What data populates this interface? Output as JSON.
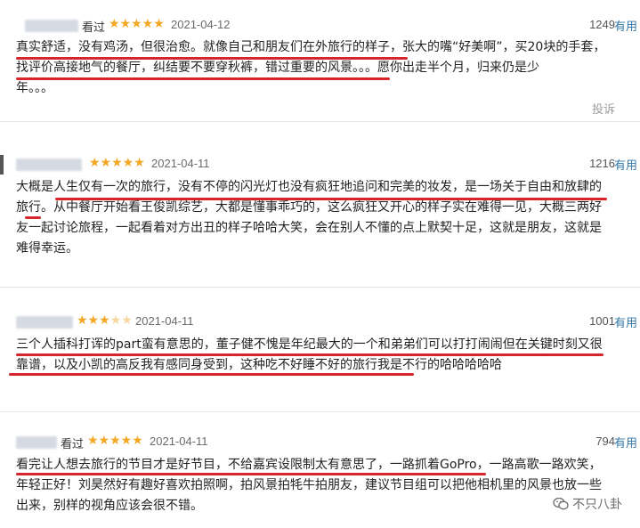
{
  "reviews": [
    {
      "seen_label": "看过",
      "stars": 5,
      "date": "2021-04-12",
      "votes": "1249",
      "useful_label": "有用",
      "lines": [
        "真实舒适，没有鸡汤，但很治愈。就像自己和朋友们在外旅行的样子，张大的嘴“好美啊”，买20块的手套，",
        "找评价高接地气的餐厅，纠结要不要穿秋裤，错过重要的风景。。。愿你出走半个月，归来仍是少",
        "年。。。"
      ],
      "report_label": "投诉"
    },
    {
      "seen_label": "看过",
      "stars": 5,
      "date": "2021-04-11",
      "votes": "1216",
      "useful_label": "有用",
      "lines": [
        "大概是人生仅有一次的旅行，没有不停的闪光灯也没有疯狂地追问和完美的妆发，是一场关于自由和放肆的",
        "旅行。从中餐厅开始看王俊凯综艺，大都是懂事乖巧的，这么疯狂又开心的样子实在难得一见，大概三两好",
        "友一起讨论旅程，一起看着对方出丑的样子哈哈大笑，会在别人不懂的点上默契十足，这就是朋友，这就是",
        "难得幸运。"
      ]
    },
    {
      "seen_label": "",
      "stars": 3,
      "date": "2021-04-11",
      "votes": "1001",
      "useful_label": "有用",
      "lines": [
        "三个人插科打诨的part蛮有意思的，董子健不愧是年纪最大的一个和弟弟们可以打打闹闹但在关键时刻又很",
        "靠谱，以及小凯的高反我有感同身受到，这种吃不好睡不好的旅行我是不行的哈哈哈哈哈"
      ]
    },
    {
      "seen_label": "看过",
      "stars": 5,
      "date": "2021-04-11",
      "votes": "794",
      "useful_label": "有用",
      "lines": [
        "看完让人想去旅行的节目才是好节目，不给嘉宾设限制太有意思了，一路抓着GoPro，一路高歌一路欢笑，",
        "年轻正好！刘昊然好有趣好喜欢拍照啊，拍风景拍牦牛拍朋友，建议节目组可以把他相机里的风景也放一些",
        "出来，别样的视角应该会很不错。"
      ]
    }
  ],
  "watermark": {
    "text": "不只八卦"
  },
  "colors": {
    "star": "#f5a623",
    "underline": "#d6262b",
    "useful_link": "#3377aa"
  }
}
